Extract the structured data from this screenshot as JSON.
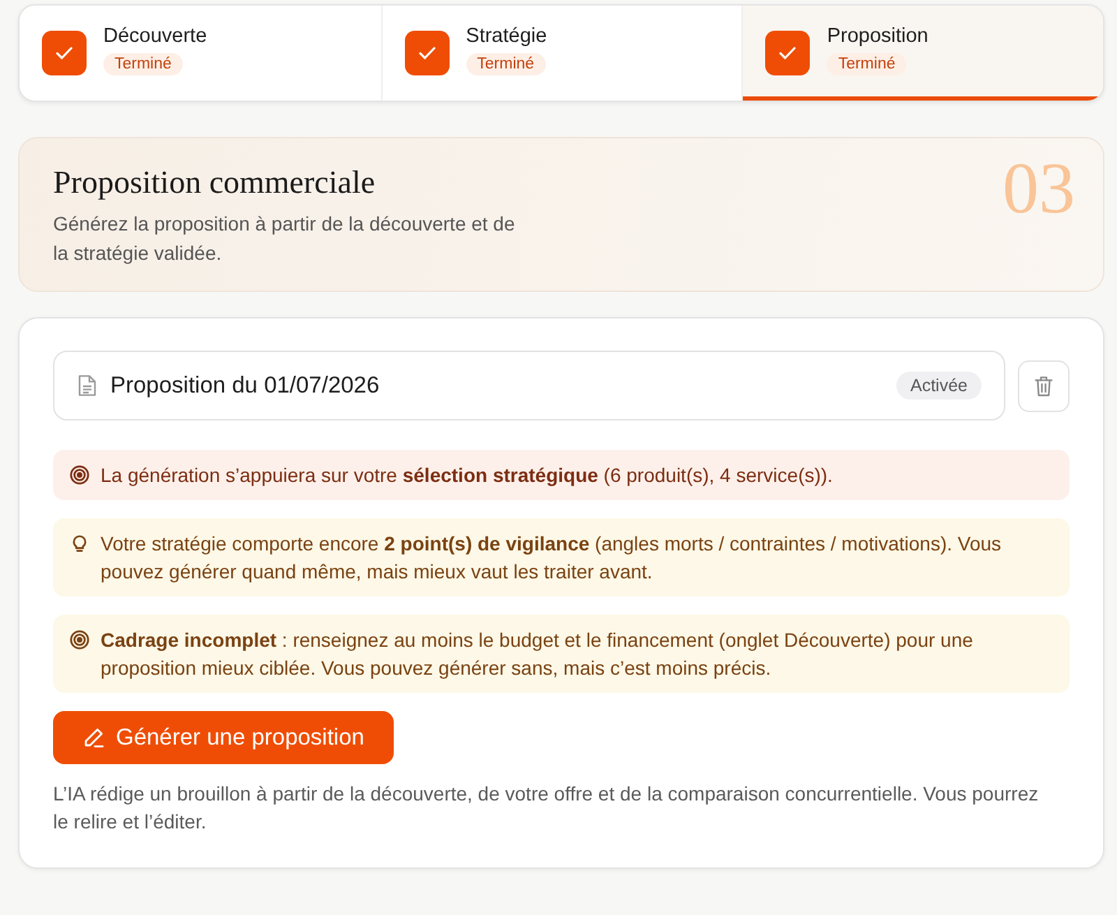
{
  "steps": [
    {
      "label": "Découverte",
      "status": "Terminé",
      "checked": true,
      "selected": false
    },
    {
      "label": "Stratégie",
      "status": "Terminé",
      "checked": true,
      "selected": false
    },
    {
      "label": "Proposition",
      "status": "Terminé",
      "checked": true,
      "selected": true
    }
  ],
  "header": {
    "title": "Proposition commerciale",
    "subtitle": "Générez la proposition à partir de la découverte et de la stratégie validée.",
    "number": "03"
  },
  "proposal": {
    "title": "Proposition du 01/07/2026",
    "badge": "Activée"
  },
  "alerts": [
    {
      "kind": "selection",
      "text": "La génération s’appuiera sur votre **sélection stratégique** (6 produit(s), 4 service(s))."
    },
    {
      "kind": "vigilance",
      "text": "Votre stratégie comporte encore **2 point(s) de vigilance** (angles morts / contraintes / motivations). Vous pouvez générer quand même, mais mieux vaut les traiter avant."
    },
    {
      "kind": "framing",
      "text": "**Cadrage incomplet** : renseignez au moins le budget et le financement (onglet Découverte) pour une proposition mieux ciblée. Vous pouvez générer sans, mais c’est moins précis."
    }
  ],
  "generate_button": {
    "label": "Générer une proposition"
  },
  "note": "L’IA rédige un brouillon à partir de la découverte, de votre offre et de la comparaison concurrentielle. Vous pourrez le relire et l’éditer."
}
